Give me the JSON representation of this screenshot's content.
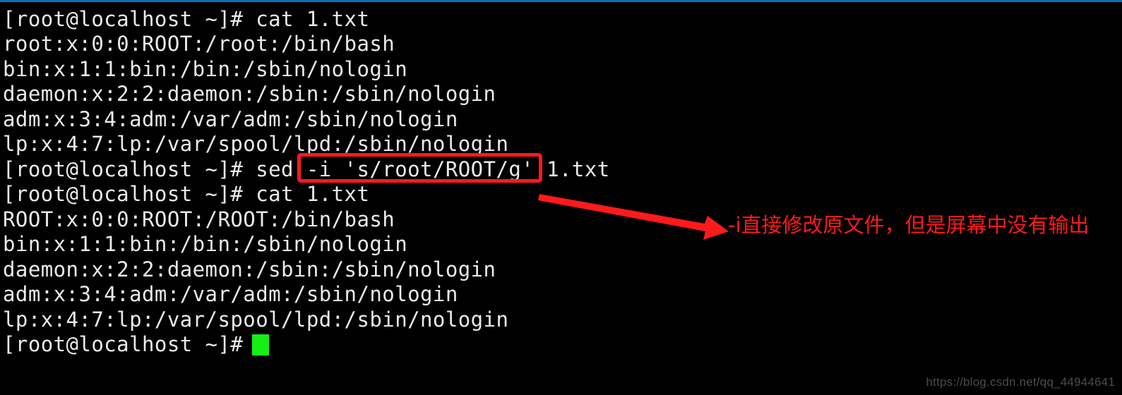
{
  "window": {
    "type": "terminal-emulator",
    "background_color": "#000000",
    "foreground_color": "#e9eaec",
    "title_rule_color": "#0a6fb8"
  },
  "terminal": {
    "prompt": "[root@localhost ~]#",
    "lines": [
      {
        "text": "[root@localhost ~]# cat 1.txt",
        "kind": "prompt-command"
      },
      {
        "text": "root:x:0:0:ROOT:/root:/bin/bash",
        "kind": "output"
      },
      {
        "text": "bin:x:1:1:bin:/bin:/sbin/nologin",
        "kind": "output"
      },
      {
        "text": "daemon:x:2:2:daemon:/sbin:/sbin/nologin",
        "kind": "output"
      },
      {
        "text": "adm:x:3:4:adm:/var/adm:/sbin/nologin",
        "kind": "output"
      },
      {
        "text": "lp:x:4:7:lp:/var/spool/lpd:/sbin/nologin",
        "kind": "output"
      },
      {
        "text": "[root@localhost ~]# sed -i 's/root/ROOT/g' 1.txt",
        "kind": "prompt-command"
      },
      {
        "text": "[root@localhost ~]# cat 1.txt",
        "kind": "prompt-command"
      },
      {
        "text": "ROOT:x:0:0:ROOT:/ROOT:/bin/bash",
        "kind": "output"
      },
      {
        "text": "bin:x:1:1:bin:/bin:/sbin/nologin",
        "kind": "output"
      },
      {
        "text": "daemon:x:2:2:daemon:/sbin:/sbin/nologin",
        "kind": "output"
      },
      {
        "text": "adm:x:3:4:adm:/var/adm:/sbin/nologin",
        "kind": "output"
      },
      {
        "text": "lp:x:4:7:lp:/var/spool/lpd:/sbin/nologin",
        "kind": "output"
      },
      {
        "text": "[root@localhost ~]# ",
        "kind": "prompt-only"
      }
    ],
    "cursor": {
      "style": "block",
      "color": "#14f014",
      "line_index": 13
    }
  },
  "annotations": {
    "highlight_box": {
      "color": "#ff1a1a",
      "targets_text": "-i 's/root/ROOT/g'",
      "on_line_index": 6
    },
    "arrow": {
      "color": "#ff1a1a",
      "direction": "down-right"
    },
    "note": {
      "color": "#ff1a1a",
      "text": "-i直接修改原文件，但是屏幕中没有输出"
    }
  },
  "watermark": {
    "text": "https://blog.csdn.net/qq_44944641",
    "color": "#4c4c4c"
  }
}
